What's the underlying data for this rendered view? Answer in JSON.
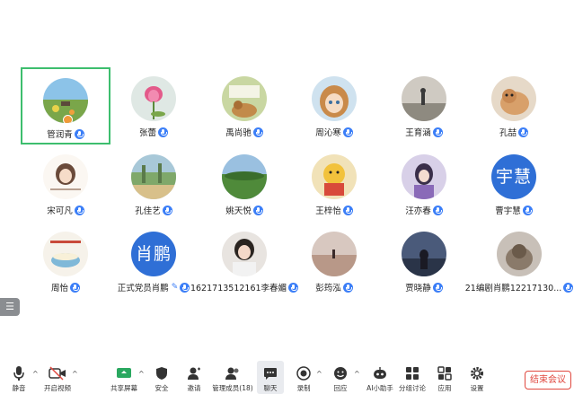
{
  "participants": [
    {
      "name": "管润青",
      "avatar": "meadow-photo",
      "active": true,
      "host": true
    },
    {
      "name": "张蕾",
      "avatar": "lotus-photo"
    },
    {
      "name": "禹尚驰",
      "avatar": "cartoon-dog-photo"
    },
    {
      "name": "周沁寒",
      "avatar": "anime-girl-photo"
    },
    {
      "name": "王育涵",
      "avatar": "road-photo"
    },
    {
      "name": "孔喆",
      "avatar": "cat-photo"
    },
    {
      "name": "宋可凡",
      "avatar": "sketch-girl-photo"
    },
    {
      "name": "孔佳艺",
      "avatar": "painting-photo"
    },
    {
      "name": "姚天悦",
      "avatar": "green-field-photo"
    },
    {
      "name": "王梓怡",
      "avatar": "winnie-photo"
    },
    {
      "name": "汪亦春",
      "avatar": "purple-girl-photo"
    },
    {
      "name": "曹宇慧",
      "avatar_text": "宇慧"
    },
    {
      "name": "周怡",
      "avatar": "bowl-drawing-photo"
    },
    {
      "name": "正式党员肖鹏",
      "avatar_text": "肖鹏",
      "editable": true
    },
    {
      "name": "1621713512161李春媚",
      "avatar": "woman-portrait-photo"
    },
    {
      "name": "彭筠泓",
      "avatar": "beach-photo"
    },
    {
      "name": "贾晓静",
      "avatar": "night-person-photo"
    },
    {
      "name": "21编剧肖鹏12217130...",
      "avatar": "cat-sofa-photo"
    }
  ],
  "toolbar": {
    "mute": "静音",
    "video": "开启视频",
    "share": "共享屏幕",
    "security": "安全",
    "invite": "邀请",
    "members": "管理成员(18)",
    "chat": "聊天",
    "record": "录制",
    "react": "回应",
    "ai": "AI小助手",
    "breakout": "分组讨论",
    "apps": "应用",
    "settings": "设置",
    "end": "结束会议"
  },
  "colors": {
    "accent": "#3b7ef7",
    "active_border": "#3dbe6e",
    "end": "#e0483f",
    "avatar_text_bg": "#2f6fd6"
  }
}
